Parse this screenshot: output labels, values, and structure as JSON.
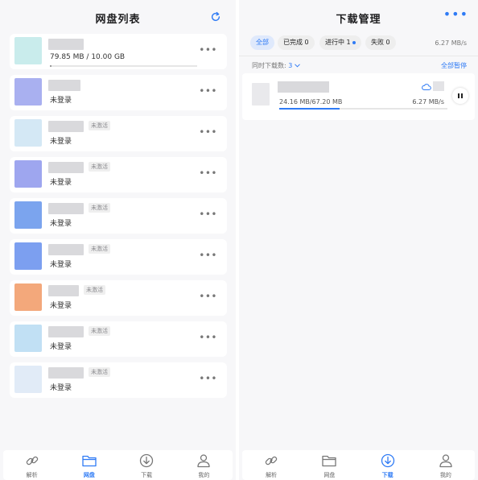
{
  "left": {
    "title": "网盘列表",
    "accounts": [
      {
        "name_blur_w": 44,
        "subtitle": "79.85 MB / 10.00 GB",
        "usage_fraction": 0.008,
        "badge": "",
        "thumb_color": "#c9ecec"
      },
      {
        "name_blur_w": 40,
        "subtitle": "未登录",
        "badge": "",
        "thumb_color": "#a9b0f0"
      },
      {
        "name_blur_w": 44,
        "subtitle": "未登录",
        "badge": "未激活",
        "thumb_color": "#d4e8f5"
      },
      {
        "name_blur_w": 44,
        "subtitle": "未登录",
        "badge": "未激活",
        "thumb_color": "#9ea6ef"
      },
      {
        "name_blur_w": 44,
        "subtitle": "未登录",
        "badge": "未激活",
        "thumb_color": "#7ba4ee"
      },
      {
        "name_blur_w": 44,
        "subtitle": "未登录",
        "badge": "未激活",
        "thumb_color": "#7c9ff0"
      },
      {
        "name_blur_w": 38,
        "subtitle": "未登录",
        "badge": "未激活",
        "thumb_color": "#f3a87b"
      },
      {
        "name_blur_w": 44,
        "subtitle": "未登录",
        "badge": "未激活",
        "thumb_color": "#c1e0f4"
      },
      {
        "name_blur_w": 44,
        "subtitle": "未登录",
        "badge": "未激活",
        "thumb_color": "#e1ebf7"
      }
    ]
  },
  "right": {
    "title": "下载管理",
    "filters": [
      {
        "label": "全部",
        "active": true
      },
      {
        "label": "已完成 0",
        "active": false
      },
      {
        "label": "进行中 1",
        "active": false,
        "dot": true
      },
      {
        "label": "失败 0",
        "active": false
      }
    ],
    "total_speed": "6.27 MB/s",
    "concurrency_label": "同时下载数:",
    "concurrency_value": "3",
    "pause_all": "全部暂停",
    "download": {
      "size": "24.16 MB/67.20 MB",
      "speed": "6.27 MB/s",
      "progress_fraction": 0.36
    }
  },
  "nav": [
    {
      "label": "解析",
      "icon": "link-icon"
    },
    {
      "label": "网盘",
      "icon": "folder-icon"
    },
    {
      "label": "下载",
      "icon": "download-icon"
    },
    {
      "label": "我的",
      "icon": "user-icon"
    }
  ],
  "colors": {
    "accent": "#2f7bf5"
  }
}
